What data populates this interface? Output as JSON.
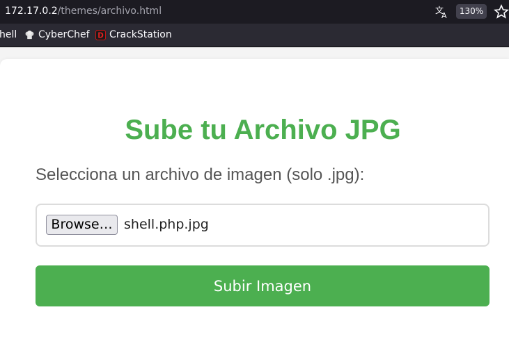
{
  "browser": {
    "url_host": "172.17.0.2",
    "url_path": "/themes/archivo.html",
    "zoom": "130%"
  },
  "bookmarks": [
    {
      "label": "hell",
      "icon": "partial-bookmark"
    },
    {
      "label": "CyberChef",
      "icon": "chef-hat-icon"
    },
    {
      "label": "CrackStation",
      "icon": "crackstation-d-icon"
    }
  ],
  "page": {
    "title": "Sube tu Archivo JPG",
    "file_label": "Selecciona un archivo de imagen (solo .jpg):",
    "browse_label": "Browse…",
    "selected_file": "shell.php.jpg",
    "submit_label": "Subir Imagen"
  },
  "colors": {
    "accent": "#4caf50",
    "toolbar_bg": "#1c1b22",
    "bookmarks_bg": "#2b2a33"
  }
}
